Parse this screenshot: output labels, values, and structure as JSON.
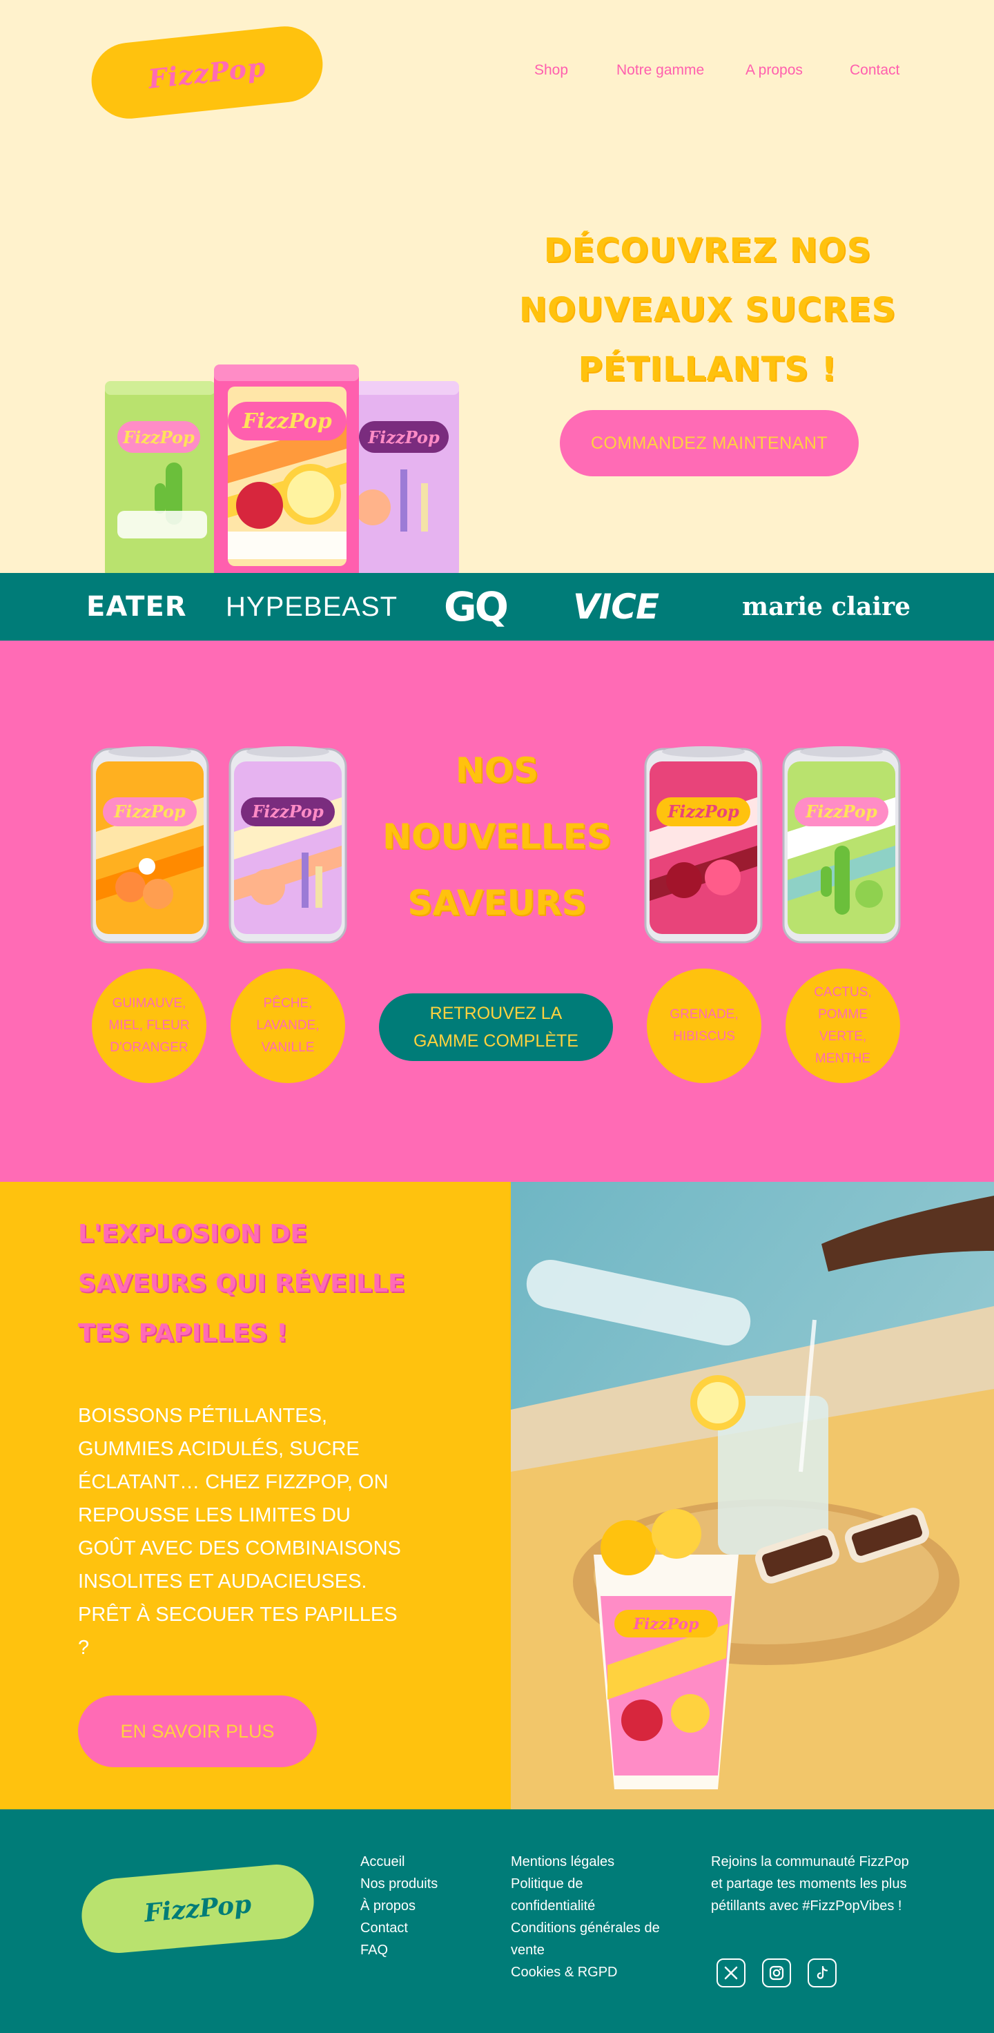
{
  "brand": {
    "name": "FizzPop"
  },
  "nav": {
    "items": [
      "Shop",
      "Notre gamme",
      "A propos",
      "Contact"
    ]
  },
  "hero": {
    "title_lines": [
      "DÉCOUVREZ NOS",
      "NOUVEAUX SUCRES",
      "PÉTILLANTS !"
    ],
    "cta_label": "COMMANDEZ MAINTENANT"
  },
  "press": {
    "logos": [
      "EATER",
      "HYPEBEAST",
      "GQ",
      "VICE",
      "marie claire"
    ]
  },
  "flavours": {
    "title_lines": [
      "NOS",
      "NOUVELLES",
      "SAVEURS"
    ],
    "cta_label": "RETROUVEZ LA GAMME COMPLÈTE",
    "items": [
      {
        "label": "GUIMAUVE, MIEL, FLEUR D'ORANGER"
      },
      {
        "label": "PÊCHE, LAVANDE, VANILLE"
      },
      {
        "label": "GRENADE, HIBISCUS"
      },
      {
        "label": "CACTUS, POMME VERTE, MENTHE"
      }
    ]
  },
  "explosion": {
    "title_lines": [
      "L'EXPLOSION DE",
      "SAVEURS QUI RÉVEILLE",
      "TES PAPILLES !"
    ],
    "text": "BOISSONS PÉTILLANTES, GUMMIES ACIDULÉS, SUCRE ÉCLATANT… CHEZ FIZZPOP, ON REPOUSSE LES LIMITES DU GOÛT AVEC DES COMBINAISONS INSOLITES ET AUDACIEUSES. PRÊT À SECOUER TES PAPILLES ?",
    "cta_label": "EN SAVOIR PLUS"
  },
  "footer": {
    "col1": [
      "Accueil",
      "Nos produits",
      "À propos",
      "Contact",
      "FAQ"
    ],
    "col2": [
      "Mentions légales",
      "Politique de confidentialité",
      "Conditions générales de vente",
      "Cookies & RGPD"
    ],
    "community": "Rejoins la communauté FizzPop et partage tes moments les plus pétillants avec #FizzPopVibes !",
    "socials": [
      "x-icon",
      "instagram-icon",
      "tiktok-icon"
    ]
  },
  "colors": {
    "cream": "#FFF2CC",
    "yellow": "#FFC20E",
    "pink": "#FF6BB5",
    "teal": "#007C78",
    "green": "#B9E26E"
  }
}
